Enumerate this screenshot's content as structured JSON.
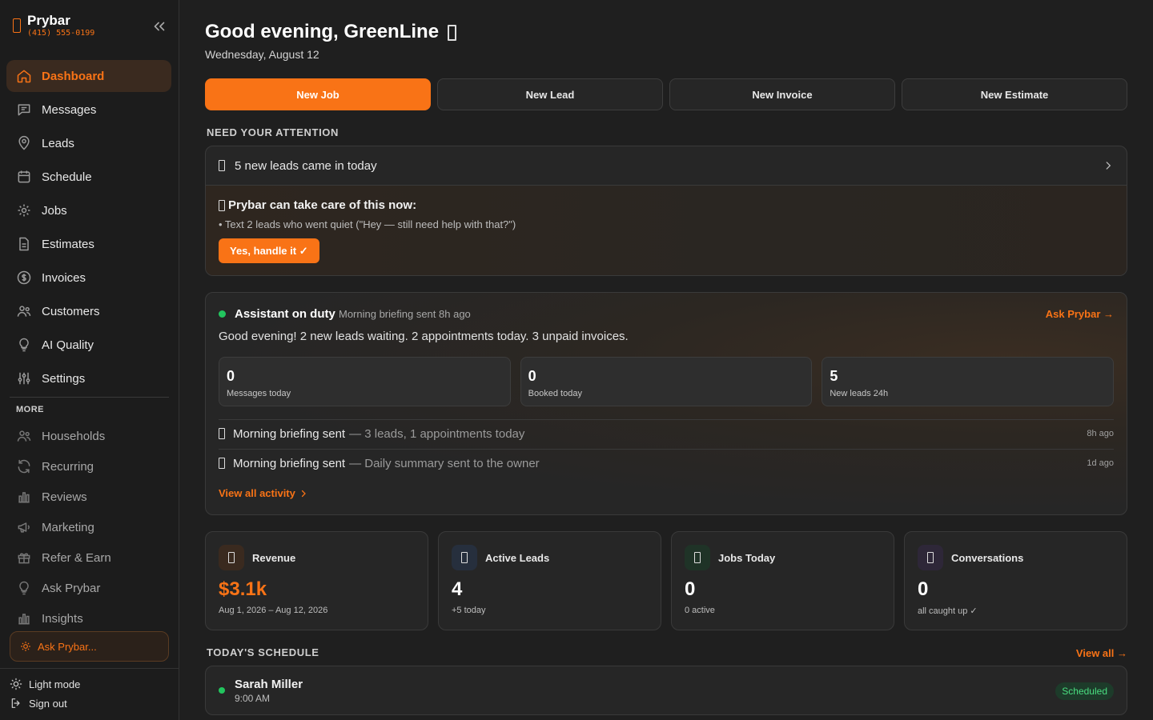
{
  "brand": {
    "name": "Prybar",
    "phone": "(415) 555-0199"
  },
  "sidebar": {
    "items": [
      {
        "label": "Dashboard"
      },
      {
        "label": "Messages"
      },
      {
        "label": "Leads"
      },
      {
        "label": "Schedule"
      },
      {
        "label": "Jobs"
      },
      {
        "label": "Estimates"
      },
      {
        "label": "Invoices"
      },
      {
        "label": "Customers"
      },
      {
        "label": "AI Quality"
      },
      {
        "label": "Settings"
      }
    ],
    "more_label": "MORE",
    "more_items": [
      {
        "label": "Households"
      },
      {
        "label": "Recurring"
      },
      {
        "label": "Reviews"
      },
      {
        "label": "Marketing"
      },
      {
        "label": "Refer & Earn"
      },
      {
        "label": "Ask Prybar"
      },
      {
        "label": "Insights"
      }
    ],
    "ask_box": "Ask Prybar...",
    "light_mode": "Light mode",
    "sign_out": "Sign out"
  },
  "header": {
    "greeting": "Good evening, GreenLine",
    "date": "Wednesday, August 12"
  },
  "actions": {
    "new_job": "New Job",
    "new_lead": "New Lead",
    "new_invoice": "New Invoice",
    "new_estimate": "New Estimate"
  },
  "attention": {
    "section_title": "NEED YOUR ATTENTION",
    "row_text": "5 new leads came in today",
    "headline": "Prybar can take care of this now:",
    "bullet": "• Text 2 leads who went quiet (\"Hey — still need help with that?\")",
    "button": "Yes, handle it ✓"
  },
  "assistant": {
    "title": "Assistant on duty",
    "subtitle": "Morning briefing sent 8h ago",
    "ask_link": "Ask Prybar →",
    "message": "Good evening! 2 new leads waiting. 2 appointments today. 3 unpaid invoices.",
    "stats": [
      {
        "value": "0",
        "label": "Messages today"
      },
      {
        "value": "0",
        "label": "Booked today"
      },
      {
        "value": "5",
        "label": "New leads 24h"
      }
    ],
    "activity": [
      {
        "title": "Morning briefing sent",
        "detail": "— 3 leads, 1 appointments today",
        "ago": "8h ago"
      },
      {
        "title": "Morning briefing sent",
        "detail": "— Daily summary sent to the owner",
        "ago": "1d ago"
      }
    ],
    "view_all": "View all activity"
  },
  "cards": [
    {
      "title": "Revenue",
      "value": "$3.1k",
      "note": "Aug 1, 2026 – Aug 12, 2026",
      "tint": "#3a2a1f"
    },
    {
      "title": "Active Leads",
      "value": "4",
      "note": "+5 today",
      "tint": "#262f3d"
    },
    {
      "title": "Jobs Today",
      "value": "0",
      "note": "0 active",
      "tint": "#1f3327"
    },
    {
      "title": "Conversations",
      "value": "0",
      "note": "all caught up ✓",
      "tint": "#2e2738"
    }
  ],
  "schedule": {
    "section_title": "TODAY'S SCHEDULE",
    "view_all": "View all →",
    "items": [
      {
        "name": "Sarah Miller",
        "time": "9:00 AM",
        "status": "Scheduled"
      }
    ]
  },
  "colors": {
    "accent": "#f97316",
    "success": "#22c55e",
    "background": "#1f1f1f"
  }
}
